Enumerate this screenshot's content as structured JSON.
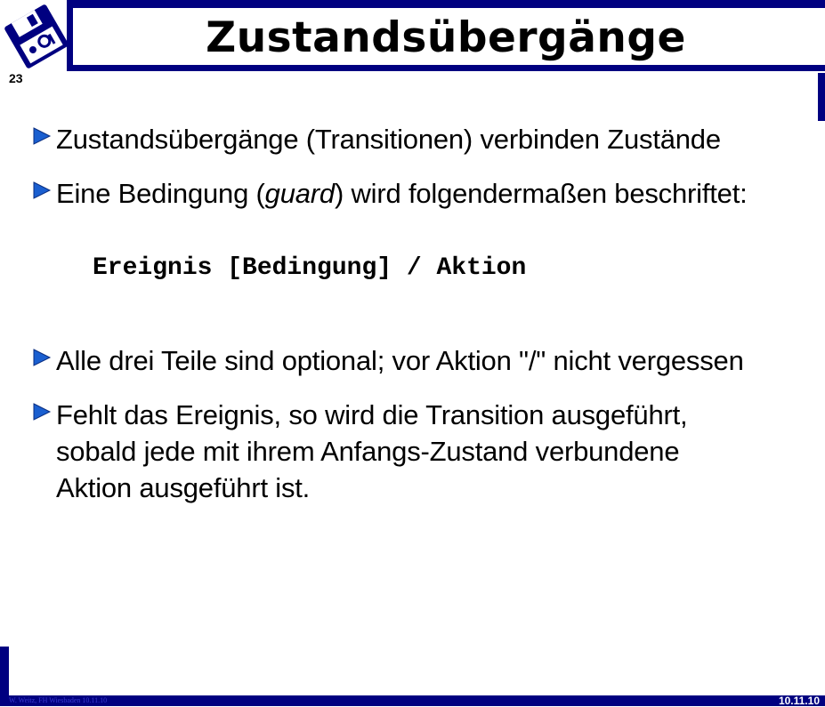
{
  "header": {
    "title": "Zustandsübergänge",
    "page_number": "23",
    "logo_icon": "floppy-disk-logo-icon"
  },
  "bullets": [
    {
      "text": "Zustandsübergänge (Transitionen) verbinden Zustände"
    },
    {
      "before": "Eine Bedingung (",
      "emphasis": "guard",
      "after": ") wird folgendermaßen beschriftet:"
    },
    {
      "text": "Alle drei Teile sind optional; vor Aktion \"/\" nicht vergessen"
    },
    {
      "lines": [
        "Fehlt das Ereignis, so wird die Transition ausgeführt,",
        "sobald jede mit ihrem Anfangs-Zustand verbundene",
        "Aktion ausgeführt ist."
      ]
    }
  ],
  "syntax": "Ereignis [Bedingung] / Aktion",
  "footer": {
    "left": "W. Weitz, FH Wiesbaden 10.11.10",
    "right": "10.11.10"
  },
  "colors": {
    "frame": "#000080",
    "bullet": "#1a5fd0"
  }
}
